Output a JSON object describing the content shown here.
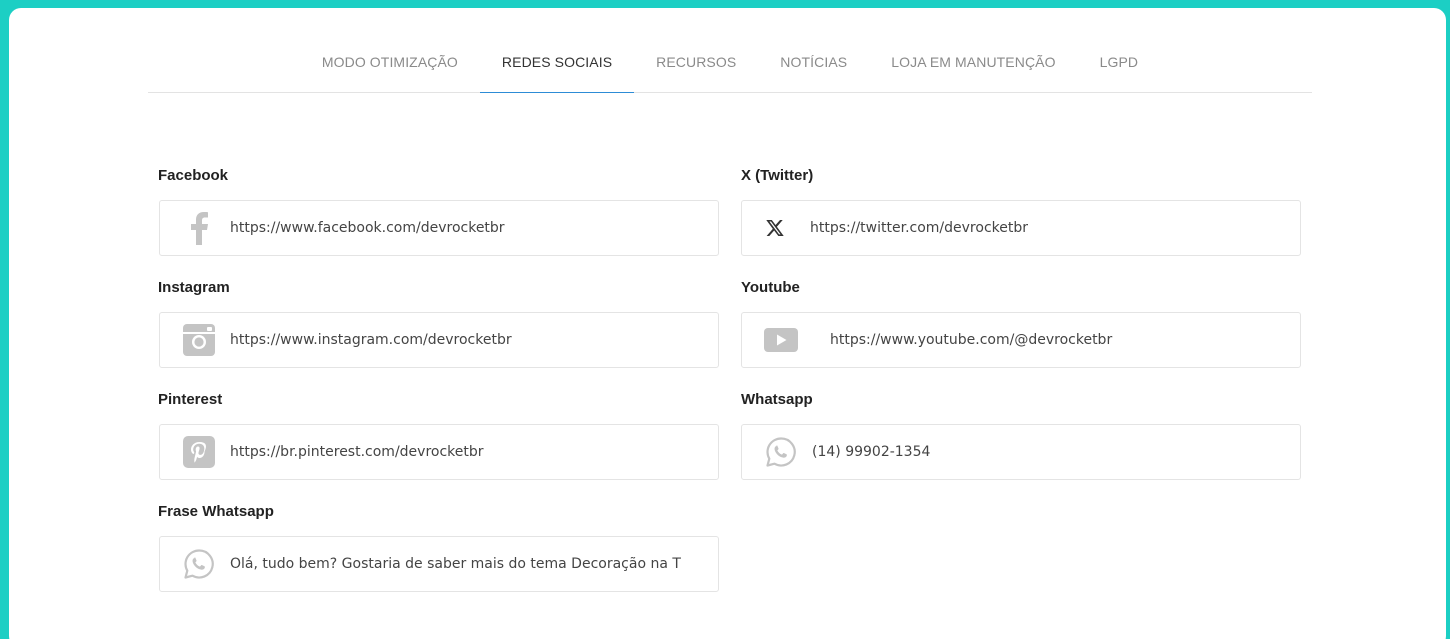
{
  "tabs": [
    {
      "label": "MODO OTIMIZAÇÃO",
      "active": false
    },
    {
      "label": "REDES SOCIAIS",
      "active": true
    },
    {
      "label": "RECURSOS",
      "active": false
    },
    {
      "label": "NOTÍCIAS",
      "active": false
    },
    {
      "label": "LOJA EM MANUTENÇÃO",
      "active": false
    },
    {
      "label": "LGPD",
      "active": false
    }
  ],
  "fields": {
    "facebook": {
      "label": "Facebook",
      "value": "https://www.facebook.com/devrocketbr",
      "icon": "facebook-icon"
    },
    "twitter": {
      "label": "X (Twitter)",
      "value": "https://twitter.com/devrocketbr",
      "icon": "x-twitter-icon"
    },
    "instagram": {
      "label": "Instagram",
      "value": "https://www.instagram.com/devrocketbr",
      "icon": "instagram-icon"
    },
    "youtube": {
      "label": "Youtube",
      "value": "https://www.youtube.com/@devrocketbr",
      "icon": "youtube-icon"
    },
    "pinterest": {
      "label": "Pinterest",
      "value": "https://br.pinterest.com/devrocketbr",
      "icon": "pinterest-icon"
    },
    "whatsapp": {
      "label": "Whatsapp",
      "value": "(14) 99902-1354",
      "icon": "whatsapp-icon"
    },
    "frase_whatsapp": {
      "label": "Frase Whatsapp",
      "value": "Olá, tudo bem? Gostaria de saber mais do tema Decoração na T",
      "icon": "whatsapp-icon"
    }
  },
  "colors": {
    "frame": "#1ccfc4",
    "active_tab_underline": "#2d8cd6",
    "icon_gray": "#c4c4c4"
  }
}
